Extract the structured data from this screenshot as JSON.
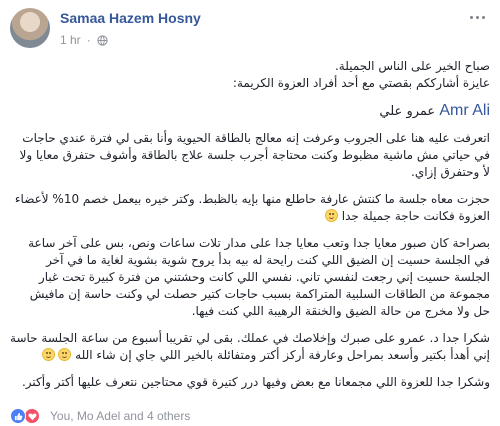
{
  "post": {
    "author": "Samaa Hazem Hosny",
    "time": "1 hr",
    "greeting_line1": "صباح الخير على الناس الجميلة.",
    "greeting_line2": "عايزة أشارككم بقصتي مع أحد أفراد العزوة الكريمة:",
    "mention_en": "Amr Ali",
    "mention_ar": "عمرو علي",
    "para1": "اتعرفت عليه هنا على الجروب وعرفت إنه معالج بالطاقة الحيوية وأنا بقى لي فترة عندي حاجات في حياتي مش ماشية مظبوط وكنت محتاجة أجرب جلسة علاج بالطاقة وأشوف حتفرق معايا ولا لأ وحتفرق إزاي.",
    "para2": "حجزت معاه جلسة ما كنتش عارفة حاطلع منها بإيه بالظبط. وكتر خيره بيعمل خصم 10% لأعضاء العزوة فكانت حاجة جميلة جدا",
    "para3": "بصراحة كان صبور معايا جدا وتعب معايا جدا على مدار تلات ساعات ونص، بس على آخر ساعة في الجلسة حسيت إن الضيق اللي كنت رايحة له بيه بدأ يروح شوية بشوية لغاية ما في آخر الجلسة حسيت إني رجعت لنفسي تاني. نفسي اللي كانت وحشتني من فترة كبيرة تحت غبار مجموعة من الطاقات السلبية المتراكمة بسبب حاجات كتير حصلت لي وكنت حاسة إن مافيش حل ولا مخرج من حالة الضيق والخنقة الرهيبة اللي كنت فيها.",
    "para4": "شكرا جدا د. عمرو على صبرك وإخلاصك في عملك. بقى لي تقريبا أسبوع من ساعة الجلسة حاسة إني أهدأ بكتير وأسعد بمراحل وعارفة أركز أكتر ومتفائلة بالخير اللي جاي إن شاء الله",
    "para5": "وشكرا جدا للعزوة اللي مجمعانا مع بعض وفيها درر كتيرة قوي محتاجين نتعرف عليها أكتر وأكتر."
  },
  "reactions": {
    "summary": "You, Mo Adel and 4 others",
    "icons": [
      "like-icon",
      "love-icon"
    ]
  },
  "colors": {
    "link": "#365899",
    "meta": "#90949c",
    "like": "#4c7ef6",
    "love": "#f25268"
  }
}
